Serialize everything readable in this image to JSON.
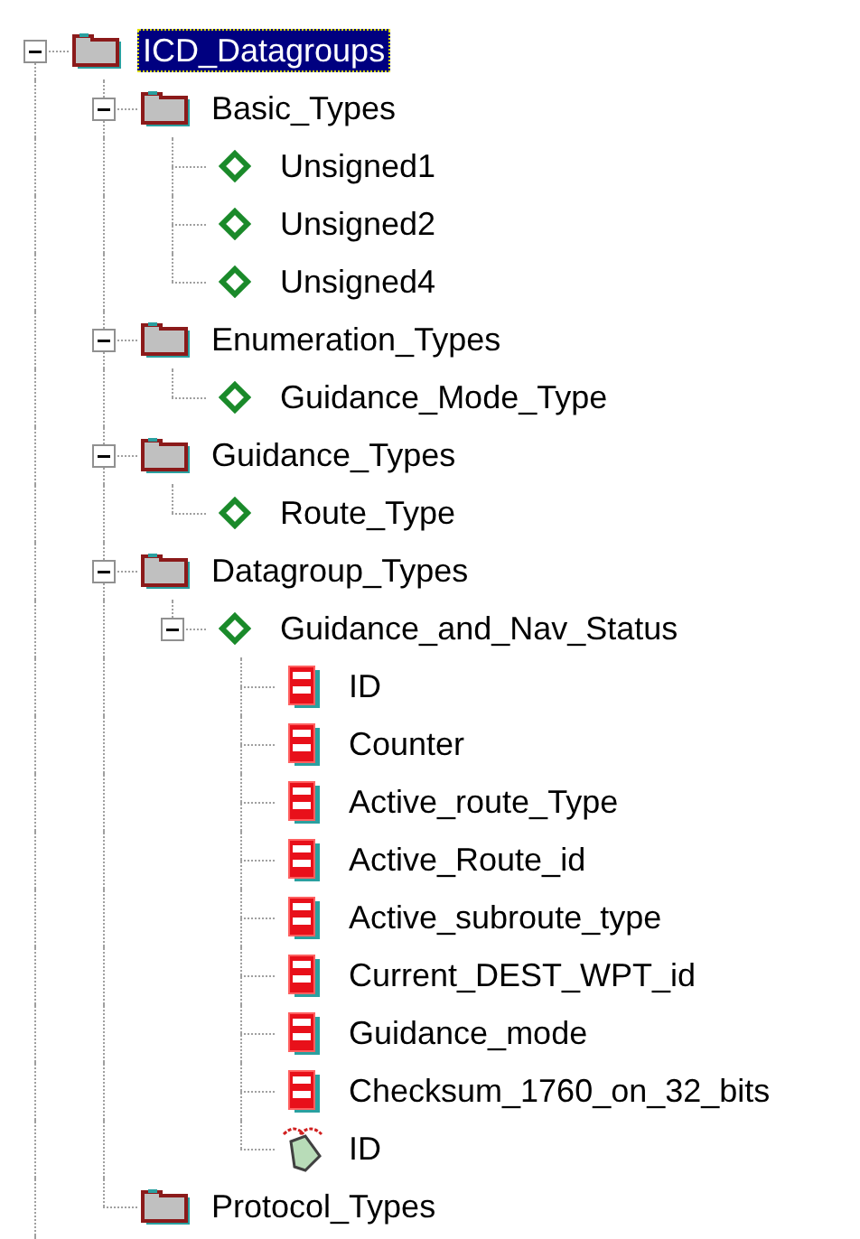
{
  "tree": [
    {
      "kind": "folder",
      "label": "ICD_Datagroups",
      "selected": true,
      "expanded": true,
      "children": [
        {
          "kind": "folder",
          "label": "Basic_Types",
          "selected": false,
          "expanded": true,
          "children": [
            {
              "kind": "type",
              "label": "Unsigned1",
              "selected": false
            },
            {
              "kind": "type",
              "label": "Unsigned2",
              "selected": false
            },
            {
              "kind": "type",
              "label": "Unsigned4",
              "selected": false
            }
          ]
        },
        {
          "kind": "folder",
          "label": "Enumeration_Types",
          "selected": false,
          "expanded": true,
          "children": [
            {
              "kind": "type",
              "label": "Guidance_Mode_Type",
              "selected": false
            }
          ]
        },
        {
          "kind": "folder",
          "label": "Guidance_Types",
          "selected": false,
          "expanded": true,
          "children": [
            {
              "kind": "type",
              "label": "Route_Type",
              "selected": false
            }
          ]
        },
        {
          "kind": "folder",
          "label": "Datagroup_Types",
          "selected": false,
          "expanded": true,
          "children": [
            {
              "kind": "type",
              "label": "Guidance_and_Nav_Status",
              "selected": false,
              "expanded": true,
              "children": [
                {
                  "kind": "field",
                  "label": "ID",
                  "selected": false
                },
                {
                  "kind": "field",
                  "label": "Counter",
                  "selected": false
                },
                {
                  "kind": "field",
                  "label": "Active_route_Type",
                  "selected": false
                },
                {
                  "kind": "field",
                  "label": "Active_Route_id",
                  "selected": false
                },
                {
                  "kind": "field",
                  "label": "Active_subroute_type",
                  "selected": false
                },
                {
                  "kind": "field",
                  "label": "Current_DEST_WPT_id",
                  "selected": false
                },
                {
                  "kind": "field",
                  "label": "Guidance_mode",
                  "selected": false
                },
                {
                  "kind": "field",
                  "label": "Checksum_1760_on_32_bits",
                  "selected": false
                },
                {
                  "kind": "tag",
                  "label": "ID",
                  "selected": false
                }
              ]
            }
          ]
        },
        {
          "kind": "folder",
          "label": "Protocol_Types",
          "selected": false
        }
      ]
    }
  ]
}
